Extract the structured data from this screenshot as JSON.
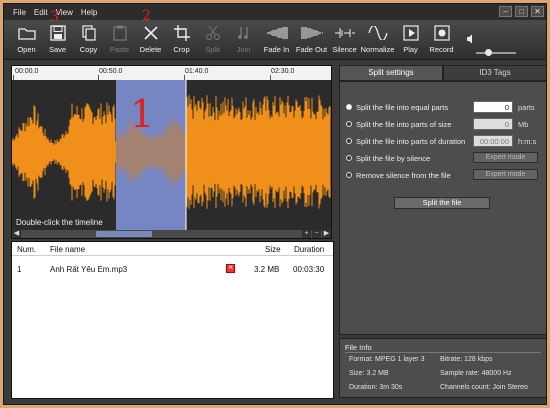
{
  "menu": [
    "File",
    "Edit",
    "View",
    "Help"
  ],
  "window_buttons": [
    "–",
    "□",
    "✕"
  ],
  "toolbar": [
    {
      "label": "Open",
      "icon": "open-folder-icon",
      "enabled": true
    },
    {
      "label": "Save",
      "icon": "save-disk-icon",
      "enabled": true
    },
    {
      "label": "Copy",
      "icon": "copy-icon",
      "enabled": true
    },
    {
      "label": "Paste",
      "icon": "paste-icon",
      "enabled": false
    },
    {
      "label": "Delete",
      "icon": "delete-x-icon",
      "enabled": true
    },
    {
      "label": "Crop",
      "icon": "crop-icon",
      "enabled": true
    },
    {
      "label": "Split",
      "icon": "scissors-icon",
      "enabled": false
    },
    {
      "label": "Join",
      "icon": "join-icon",
      "enabled": false
    },
    {
      "label": "Fade In",
      "icon": "fade-in-icon",
      "enabled": true
    },
    {
      "label": "Fade Out",
      "icon": "fade-out-icon",
      "enabled": true
    },
    {
      "label": "Silence",
      "icon": "silence-icon",
      "enabled": true
    },
    {
      "label": "Normalize",
      "icon": "normalize-icon",
      "enabled": true
    },
    {
      "label": "Play",
      "icon": "play-icon",
      "enabled": true
    },
    {
      "label": "Record",
      "icon": "record-icon",
      "enabled": true
    }
  ],
  "volume_level": 0.3,
  "timeline": {
    "ticks": [
      "00:00.0",
      "00:50.0",
      "01:40.0",
      "02:30.0"
    ],
    "hint": "Double-click the timeline"
  },
  "annotations": [
    "1",
    "2",
    "3"
  ],
  "table": {
    "headers": [
      "Num.",
      "File name",
      "Size",
      "Duration"
    ],
    "rows": [
      {
        "num": "1",
        "name": "Anh Rất Yêu Em.mp3",
        "size": "3.2 MB",
        "duration": "00:03:30"
      }
    ]
  },
  "tabs": [
    "Split settings",
    "ID3 Tags"
  ],
  "split": {
    "options": [
      "Split the file into equal parts",
      "Split the file into parts of size",
      "Split the file into parts of duration",
      "Split the file by silence",
      "Remove silence from the file"
    ],
    "parts_value": "0",
    "parts_unit": "parts",
    "size_value": "0",
    "size_unit": "Mb",
    "duration_value": "00:00:00",
    "duration_unit": "h:m:s",
    "expert_label": "Expert mode",
    "split_button": "Split the file"
  },
  "file_info": {
    "title": "File Info",
    "format": "Format: MPEG 1 layer 3",
    "bitrate": "Bitrate: 128 kbps",
    "size": "Size: 3.2 MB",
    "sample_rate": "Sample rate: 48000 Hz",
    "duration": "Duration: 3m 30s",
    "channels": "Channels count: Join Stereo"
  },
  "colors": {
    "waveform": "#f0901a",
    "selection": "#8899cc",
    "panel": "#4d4d4d",
    "annotation": "#dd2222"
  }
}
